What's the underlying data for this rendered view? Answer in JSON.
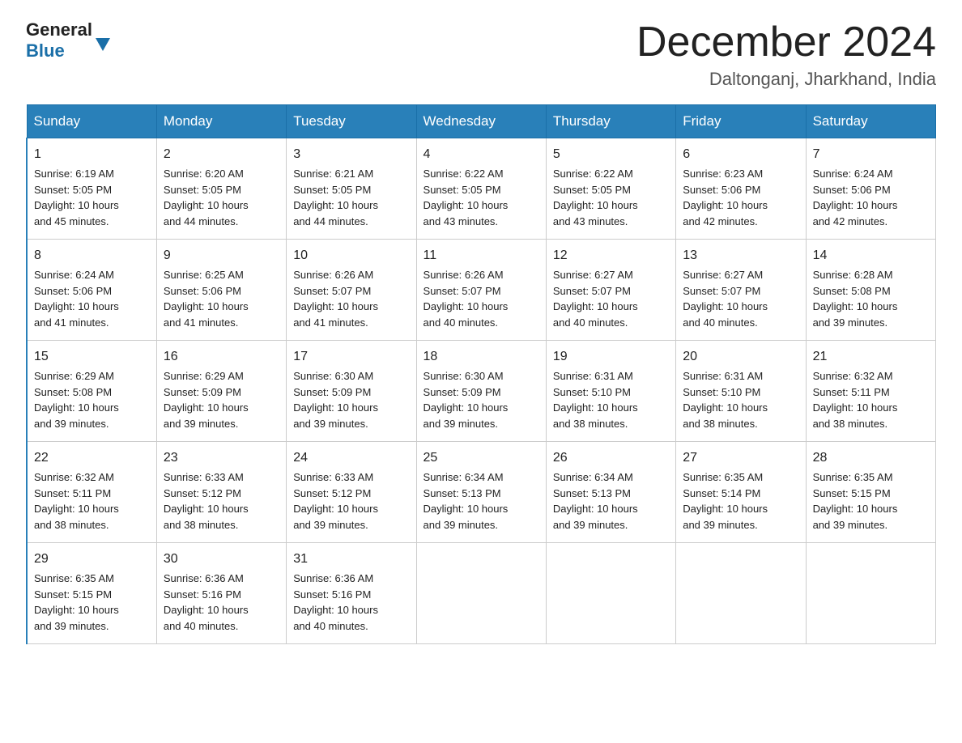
{
  "header": {
    "logo_text_general": "General",
    "logo_text_blue": "Blue",
    "month_year": "December 2024",
    "location": "Daltonganj, Jharkhand, India"
  },
  "days_of_week": [
    "Sunday",
    "Monday",
    "Tuesday",
    "Wednesday",
    "Thursday",
    "Friday",
    "Saturday"
  ],
  "weeks": [
    [
      {
        "day": "1",
        "sunrise": "6:19 AM",
        "sunset": "5:05 PM",
        "daylight": "10 hours and 45 minutes."
      },
      {
        "day": "2",
        "sunrise": "6:20 AM",
        "sunset": "5:05 PM",
        "daylight": "10 hours and 44 minutes."
      },
      {
        "day": "3",
        "sunrise": "6:21 AM",
        "sunset": "5:05 PM",
        "daylight": "10 hours and 44 minutes."
      },
      {
        "day": "4",
        "sunrise": "6:22 AM",
        "sunset": "5:05 PM",
        "daylight": "10 hours and 43 minutes."
      },
      {
        "day": "5",
        "sunrise": "6:22 AM",
        "sunset": "5:05 PM",
        "daylight": "10 hours and 43 minutes."
      },
      {
        "day": "6",
        "sunrise": "6:23 AM",
        "sunset": "5:06 PM",
        "daylight": "10 hours and 42 minutes."
      },
      {
        "day": "7",
        "sunrise": "6:24 AM",
        "sunset": "5:06 PM",
        "daylight": "10 hours and 42 minutes."
      }
    ],
    [
      {
        "day": "8",
        "sunrise": "6:24 AM",
        "sunset": "5:06 PM",
        "daylight": "10 hours and 41 minutes."
      },
      {
        "day": "9",
        "sunrise": "6:25 AM",
        "sunset": "5:06 PM",
        "daylight": "10 hours and 41 minutes."
      },
      {
        "day": "10",
        "sunrise": "6:26 AM",
        "sunset": "5:07 PM",
        "daylight": "10 hours and 41 minutes."
      },
      {
        "day": "11",
        "sunrise": "6:26 AM",
        "sunset": "5:07 PM",
        "daylight": "10 hours and 40 minutes."
      },
      {
        "day": "12",
        "sunrise": "6:27 AM",
        "sunset": "5:07 PM",
        "daylight": "10 hours and 40 minutes."
      },
      {
        "day": "13",
        "sunrise": "6:27 AM",
        "sunset": "5:07 PM",
        "daylight": "10 hours and 40 minutes."
      },
      {
        "day": "14",
        "sunrise": "6:28 AM",
        "sunset": "5:08 PM",
        "daylight": "10 hours and 39 minutes."
      }
    ],
    [
      {
        "day": "15",
        "sunrise": "6:29 AM",
        "sunset": "5:08 PM",
        "daylight": "10 hours and 39 minutes."
      },
      {
        "day": "16",
        "sunrise": "6:29 AM",
        "sunset": "5:09 PM",
        "daylight": "10 hours and 39 minutes."
      },
      {
        "day": "17",
        "sunrise": "6:30 AM",
        "sunset": "5:09 PM",
        "daylight": "10 hours and 39 minutes."
      },
      {
        "day": "18",
        "sunrise": "6:30 AM",
        "sunset": "5:09 PM",
        "daylight": "10 hours and 39 minutes."
      },
      {
        "day": "19",
        "sunrise": "6:31 AM",
        "sunset": "5:10 PM",
        "daylight": "10 hours and 38 minutes."
      },
      {
        "day": "20",
        "sunrise": "6:31 AM",
        "sunset": "5:10 PM",
        "daylight": "10 hours and 38 minutes."
      },
      {
        "day": "21",
        "sunrise": "6:32 AM",
        "sunset": "5:11 PM",
        "daylight": "10 hours and 38 minutes."
      }
    ],
    [
      {
        "day": "22",
        "sunrise": "6:32 AM",
        "sunset": "5:11 PM",
        "daylight": "10 hours and 38 minutes."
      },
      {
        "day": "23",
        "sunrise": "6:33 AM",
        "sunset": "5:12 PM",
        "daylight": "10 hours and 38 minutes."
      },
      {
        "day": "24",
        "sunrise": "6:33 AM",
        "sunset": "5:12 PM",
        "daylight": "10 hours and 39 minutes."
      },
      {
        "day": "25",
        "sunrise": "6:34 AM",
        "sunset": "5:13 PM",
        "daylight": "10 hours and 39 minutes."
      },
      {
        "day": "26",
        "sunrise": "6:34 AM",
        "sunset": "5:13 PM",
        "daylight": "10 hours and 39 minutes."
      },
      {
        "day": "27",
        "sunrise": "6:35 AM",
        "sunset": "5:14 PM",
        "daylight": "10 hours and 39 minutes."
      },
      {
        "day": "28",
        "sunrise": "6:35 AM",
        "sunset": "5:15 PM",
        "daylight": "10 hours and 39 minutes."
      }
    ],
    [
      {
        "day": "29",
        "sunrise": "6:35 AM",
        "sunset": "5:15 PM",
        "daylight": "10 hours and 39 minutes."
      },
      {
        "day": "30",
        "sunrise": "6:36 AM",
        "sunset": "5:16 PM",
        "daylight": "10 hours and 40 minutes."
      },
      {
        "day": "31",
        "sunrise": "6:36 AM",
        "sunset": "5:16 PM",
        "daylight": "10 hours and 40 minutes."
      },
      null,
      null,
      null,
      null
    ]
  ],
  "labels": {
    "sunrise": "Sunrise:",
    "sunset": "Sunset:",
    "daylight": "Daylight:"
  }
}
